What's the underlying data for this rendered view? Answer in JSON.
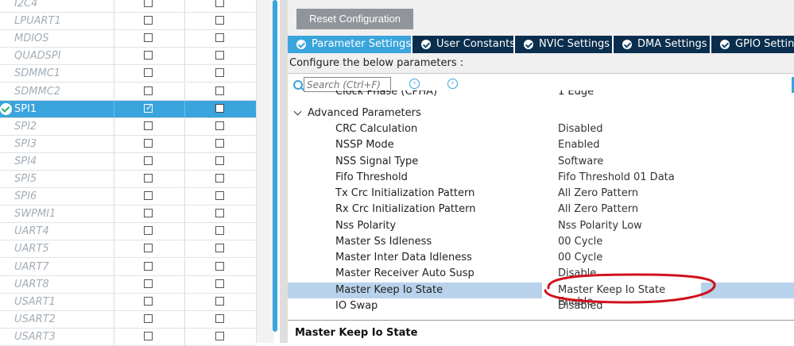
{
  "peripherals": [
    {
      "name": "I2C4",
      "selected": false,
      "check1": false,
      "check2": false
    },
    {
      "name": "LPUART1",
      "selected": false,
      "check1": false,
      "check2": false
    },
    {
      "name": "MDIOS",
      "selected": false,
      "check1": false,
      "check2": false
    },
    {
      "name": "QUADSPI",
      "selected": false,
      "check1": false,
      "check2": false
    },
    {
      "name": "SDMMC1",
      "selected": false,
      "check1": false,
      "check2": false
    },
    {
      "name": "SDMMC2",
      "selected": false,
      "check1": false,
      "check2": false
    },
    {
      "name": "SPI1",
      "selected": true,
      "check1": true,
      "check2": false
    },
    {
      "name": "SPI2",
      "selected": false,
      "check1": false,
      "check2": false
    },
    {
      "name": "SPI3",
      "selected": false,
      "check1": false,
      "check2": false
    },
    {
      "name": "SPI4",
      "selected": false,
      "check1": false,
      "check2": false
    },
    {
      "name": "SPI5",
      "selected": false,
      "check1": false,
      "check2": false
    },
    {
      "name": "SPI6",
      "selected": false,
      "check1": false,
      "check2": false
    },
    {
      "name": "SWPMI1",
      "selected": false,
      "check1": false,
      "check2": false
    },
    {
      "name": "UART4",
      "selected": false,
      "check1": false,
      "check2": false
    },
    {
      "name": "UART5",
      "selected": false,
      "check1": false,
      "check2": false
    },
    {
      "name": "UART7",
      "selected": false,
      "check1": false,
      "check2": false
    },
    {
      "name": "UART8",
      "selected": false,
      "check1": false,
      "check2": false
    },
    {
      "name": "USART1",
      "selected": false,
      "check1": false,
      "check2": false
    },
    {
      "name": "USART2",
      "selected": false,
      "check1": false,
      "check2": false
    },
    {
      "name": "USART3",
      "selected": false,
      "check1": false,
      "check2": false
    }
  ],
  "toolbar": {
    "reset_label": "Reset Configuration"
  },
  "tabs": [
    {
      "label": "Parameter Settings",
      "active": true
    },
    {
      "label": "User Constants",
      "active": false
    },
    {
      "label": "NVIC Settings",
      "active": false
    },
    {
      "label": "DMA Settings",
      "active": false
    },
    {
      "label": "GPIO Settings",
      "active": false
    }
  ],
  "config": {
    "label": "Configure the below parameters :",
    "search_placeholder": "Search (Ctrl+F)",
    "truncated_row": {
      "name": "Clock Phase (CPHA)",
      "value": "1 Edge"
    },
    "section_title": "Advanced Parameters",
    "params": [
      {
        "name": "CRC Calculation",
        "value": "Disabled",
        "highlighted": false
      },
      {
        "name": "NSSP Mode",
        "value": "Enabled",
        "highlighted": false
      },
      {
        "name": "NSS Signal Type",
        "value": "Software",
        "highlighted": false
      },
      {
        "name": "Fifo Threshold",
        "value": "Fifo Threshold 01 Data",
        "highlighted": false
      },
      {
        "name": "Tx Crc Initialization Pattern",
        "value": "All Zero Pattern",
        "highlighted": false
      },
      {
        "name": "Rx Crc Initialization Pattern",
        "value": "All Zero Pattern",
        "highlighted": false
      },
      {
        "name": "Nss Polarity",
        "value": "Nss Polarity Low",
        "highlighted": false
      },
      {
        "name": "Master Ss Idleness",
        "value": "00 Cycle",
        "highlighted": false
      },
      {
        "name": "Master Inter Data Idleness",
        "value": "00 Cycle",
        "highlighted": false
      },
      {
        "name": "Master Receiver Auto Susp",
        "value": "Disable",
        "highlighted": false
      },
      {
        "name": "Master Keep Io State",
        "value": "Master Keep Io State Enable",
        "highlighted": true
      },
      {
        "name": "IO Swap",
        "value": "Disabled",
        "highlighted": false
      }
    ],
    "description_title": "Master Keep Io State"
  },
  "colors": {
    "accent": "#3aa4dc",
    "tab_bar": "#0b2e4e",
    "annotation": "#d0121c"
  }
}
